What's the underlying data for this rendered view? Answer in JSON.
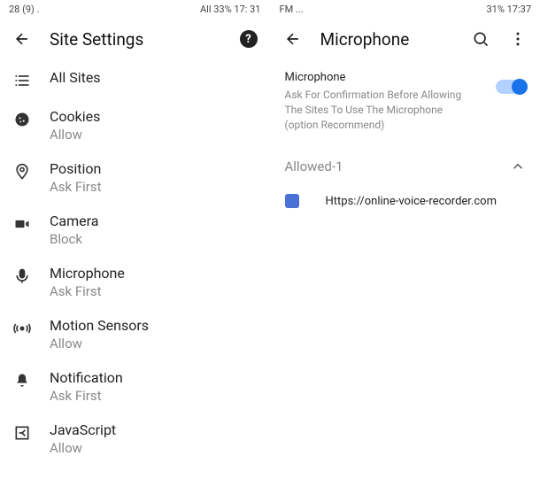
{
  "left": {
    "statusbar": {
      "leading": "28 (9) .",
      "trailing": "All 33% 17: 31"
    },
    "appbar": {
      "title": "Site Settings"
    },
    "items": [
      {
        "label": "All Sites",
        "sub": ""
      },
      {
        "label": "Cookies",
        "sub": "Allow"
      },
      {
        "label": "Position",
        "sub": "Ask First"
      },
      {
        "label": "Camera",
        "sub": "Block"
      },
      {
        "label": "Microphone",
        "sub": "Ask First"
      },
      {
        "label": "Motion Sensors",
        "sub": "Allow"
      },
      {
        "label": "Notification",
        "sub": "Ask First"
      },
      {
        "label": "JavaScript",
        "sub": "Allow"
      }
    ]
  },
  "right": {
    "statusbar": {
      "leading": "FM ...",
      "trailing": "31% 17:37"
    },
    "appbar": {
      "title": "Microphone"
    },
    "toggle": {
      "title": "Microphone",
      "desc": "Ask For Confirmation Before Allowing The Sites To Use The Microphone (option Recommend)"
    },
    "section": {
      "label": "Allowed-1"
    },
    "sites": [
      {
        "url": "Https://online-voice-recorder.com"
      }
    ]
  }
}
